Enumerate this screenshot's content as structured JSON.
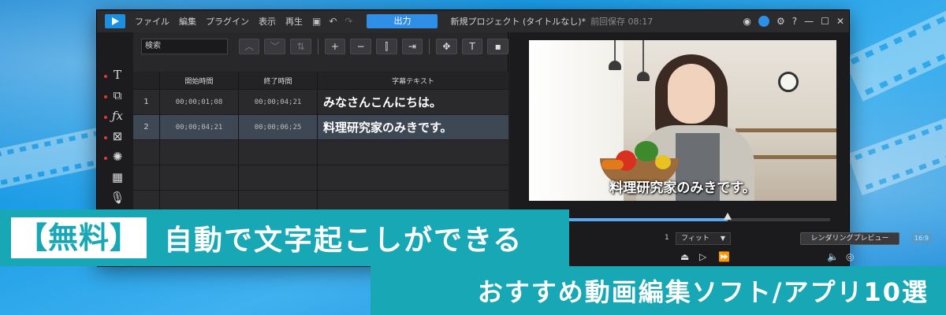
{
  "titlebar": {
    "menu": [
      "ファイル",
      "編集",
      "プラグイン",
      "表示",
      "再生"
    ],
    "output_label": "出力",
    "project_title": "新規プロジェクト (タイトルなし)*",
    "save_info": "前回保存 08:17",
    "right_icons": [
      "user-icon",
      "notification-icon",
      "settings-icon",
      "help-icon",
      "minimize-icon",
      "maximize-icon",
      "close-icon"
    ],
    "help_glyph": "?"
  },
  "toolstrip": [
    "title-tool-icon",
    "transition-tool-icon",
    "fx-tool-icon",
    "pip-tool-icon",
    "particle-tool-icon",
    "chapter-tool-icon",
    "voice-tool-icon"
  ],
  "subtitle_panel": {
    "search_placeholder": "検索",
    "columns": [
      "",
      "開始時間",
      "終了時間",
      "字幕テキスト"
    ],
    "rows": [
      {
        "index": "1",
        "start": "00;00;01;08",
        "end": "00;00;04;21",
        "text": "みなさんこんにちは。"
      },
      {
        "index": "2",
        "start": "00;00;04;21",
        "end": "00;00;06;25",
        "text": "料理研究家のみきです。"
      }
    ]
  },
  "preview": {
    "caption": "料理研究家のみきです。",
    "fit_label": "フィット",
    "zoom_fragment": "1",
    "render_label": "レンダリングプレビュー",
    "aspect_label": "16:9",
    "playhead_fraction": 0.66
  },
  "banner": {
    "badge": "【無料】",
    "headline": "自動で文字起こしができる",
    "subline": "おすすめ動画編集ソフト/アプリ10選"
  },
  "colors": {
    "accent_teal": "#18a7b5",
    "app_blue": "#2f8fe6",
    "background_blue": "#1a9be6",
    "row_selected": "#3e4754"
  }
}
